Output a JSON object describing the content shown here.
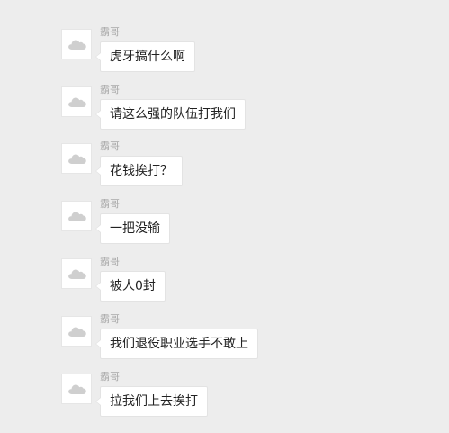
{
  "colors": {
    "background": "#ededed",
    "bubble": "#ffffff",
    "sender_name": "#a9a9a9",
    "text": "#222222"
  },
  "avatar_icon": "cloud-placeholder-icon",
  "messages": [
    {
      "sender": "霸哥",
      "text": "虎牙搞什么啊"
    },
    {
      "sender": "霸哥",
      "text": "请这么强的队伍打我们"
    },
    {
      "sender": "霸哥",
      "text": "花钱挨打？"
    },
    {
      "sender": "霸哥",
      "text": "一把没输"
    },
    {
      "sender": "霸哥",
      "text": "被人0封"
    },
    {
      "sender": "霸哥",
      "text": "我们退役职业选手不敢上"
    },
    {
      "sender": "霸哥",
      "text": "拉我们上去挨打"
    }
  ]
}
